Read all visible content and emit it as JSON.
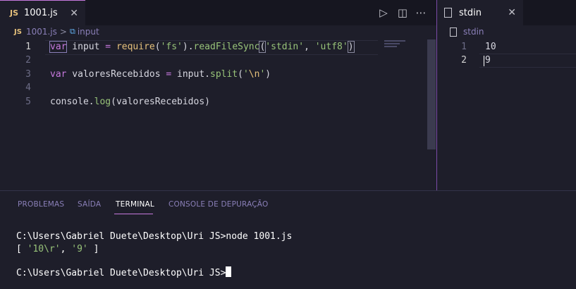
{
  "editor": {
    "tab": {
      "badge": "JS",
      "label": "1001.js",
      "close": "✕"
    },
    "breadcrumb": {
      "badge": "JS",
      "file": "1001.js",
      "separator": ">",
      "symbol": "input"
    },
    "actions": {
      "run": "▷",
      "split": "◫",
      "more": "⋯"
    },
    "lines": [
      {
        "num": "1"
      },
      {
        "num": "2"
      },
      {
        "num": "3"
      },
      {
        "num": "4"
      },
      {
        "num": "5"
      }
    ],
    "code": {
      "l1": {
        "kw": "var",
        "name": " input ",
        "eq": "=",
        "sp": " ",
        "fn": "require",
        "p1": "(",
        "s1": "'fs'",
        "p2": ").",
        "m1": "readFileSync",
        "p3": "(",
        "s2": "'stdin'",
        "c1": ", ",
        "s3": "'utf8'",
        "p4": ")"
      },
      "l3": {
        "kw": "var",
        "name": " valoresRecebidos ",
        "eq": "=",
        "obj": " input.",
        "m1": "split",
        "p1": "(",
        "s1a": "'",
        "esc": "\\n",
        "s1b": "'",
        "p2": ")"
      },
      "l5": {
        "obj": "console.",
        "m1": "log",
        "p1": "(",
        "arg": "valoresRecebidos",
        "p2": ")"
      }
    }
  },
  "stdin": {
    "tab": {
      "label": "stdin",
      "close": "✕"
    },
    "breadcrumb": {
      "label": "stdin"
    },
    "lines": [
      {
        "num": "1",
        "text": "10"
      },
      {
        "num": "2",
        "text": "9"
      }
    ]
  },
  "panel": {
    "tabs": [
      "PROBLEMAS",
      "SAÍDA",
      "TERMINAL",
      "CONSOLE DE DEPURAÇÃO"
    ],
    "active_tab": "TERMINAL",
    "terminal": {
      "command_line": "C:\\Users\\Gabriel Duete\\Desktop\\Uri JS>node 1001.js",
      "output": {
        "open": "[ ",
        "v1": "'10\\r'",
        "sep": ", ",
        "v2": "'9'",
        "close": " ]"
      },
      "prompt": "C:\\Users\\Gabriel Duete\\Desktop\\Uri JS>"
    }
  },
  "colors": {
    "accent": "#c678dd",
    "string": "#98c379",
    "function": "#e5c07b",
    "background": "#1e1e2a"
  }
}
